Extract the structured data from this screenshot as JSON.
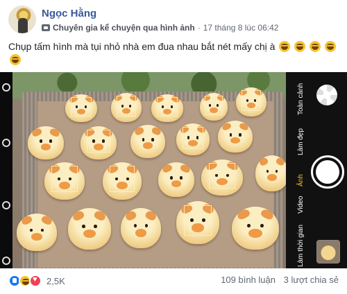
{
  "post": {
    "author": "Ngọc Hằng",
    "badge_icon": "badge-icon",
    "badge_label": "Chuyên gia kể chuyện qua hình ảnh",
    "separator": "·",
    "timestamp": "17 tháng 8 lúc 06:42",
    "text": "Chụp tấm hình mà tụi nhỏ nhà em đua nhau bắt nét mấy chị à",
    "emoji_count": 5
  },
  "camera": {
    "modes": [
      "Toàn cảnh",
      "Làm đẹp",
      "Ảnh",
      "Video",
      "Làm thời gian"
    ],
    "active_mode": "Ảnh",
    "active_color": "#f7c52b"
  },
  "footer": {
    "reaction_icons": [
      "like-icon",
      "haha-icon",
      "love-icon"
    ],
    "reaction_count": "2,5K",
    "comments": "109 bình luận",
    "shares": "3 lượt chia sẻ"
  }
}
